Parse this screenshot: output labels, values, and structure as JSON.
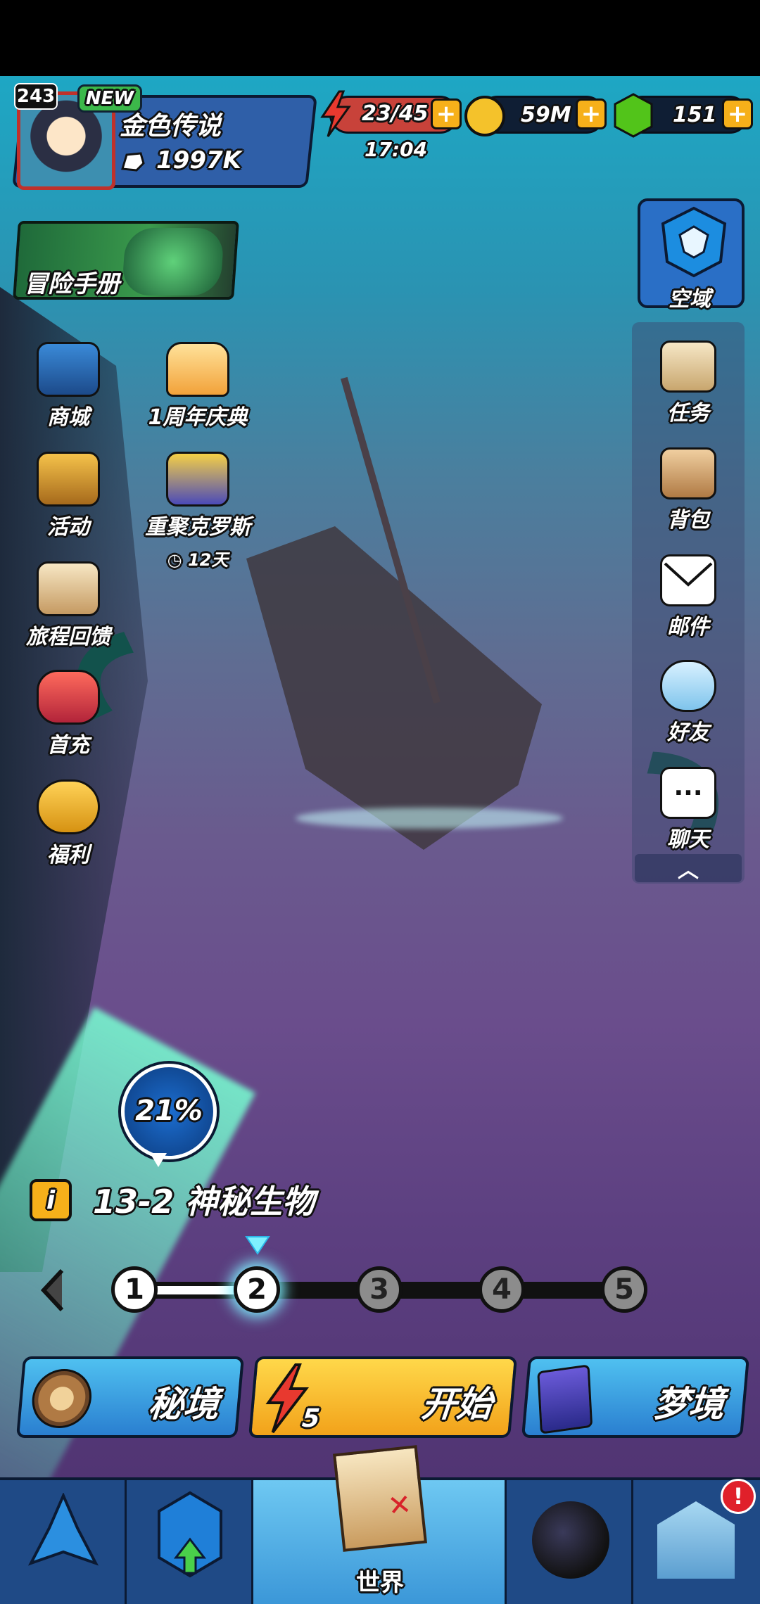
{
  "player": {
    "level": "243",
    "new_badge": "NEW",
    "name": "金色传说",
    "power": "1997K"
  },
  "resources": {
    "energy": "23/45",
    "energy_timer": "17:04",
    "gold": "59M",
    "gems": "151"
  },
  "banner": {
    "adventure_handbook": "冒险手册"
  },
  "zone_button": {
    "label": "空域"
  },
  "left_menu": [
    {
      "label": "商城",
      "icon": "shop-chest-icon"
    },
    {
      "label": "1周年庆典",
      "icon": "cake-icon"
    },
    {
      "label": "活动",
      "icon": "event-chest-icon"
    },
    {
      "label": "重聚克罗斯",
      "icon": "reunion-icon",
      "timer": "12天"
    },
    {
      "label": "旅程回馈",
      "icon": "clipboard-icon"
    },
    {
      "label": "首充",
      "icon": "first-recharge-icon"
    },
    {
      "label": "福利",
      "icon": "piggy-bank-icon"
    }
  ],
  "right_menu": [
    {
      "label": "任务",
      "icon": "scroll-icon"
    },
    {
      "label": "背包",
      "icon": "backpack-icon"
    },
    {
      "label": "邮件",
      "icon": "mail-icon"
    },
    {
      "label": "好友",
      "icon": "friends-icon"
    },
    {
      "label": "聊天",
      "icon": "chat-icon"
    }
  ],
  "progress": {
    "percent": "21%",
    "value": 0.21
  },
  "stage": {
    "info_icon": "i",
    "title": "13-2 神秘生物"
  },
  "stage_nodes": [
    "1",
    "2",
    "3",
    "4",
    "5"
  ],
  "stage_current": 2,
  "actions": {
    "secret_realm": "秘境",
    "start": "开始",
    "start_cost": "5",
    "dreamland": "梦境"
  },
  "tabbar": {
    "world": "世界"
  },
  "colors": {
    "accent_yellow": "#f6b01a",
    "panel_blue": "#2f5fa8",
    "sky_cyan": "#1ea7c4",
    "ground_purple": "#5c3f80",
    "notification_red": "#e0202a"
  }
}
